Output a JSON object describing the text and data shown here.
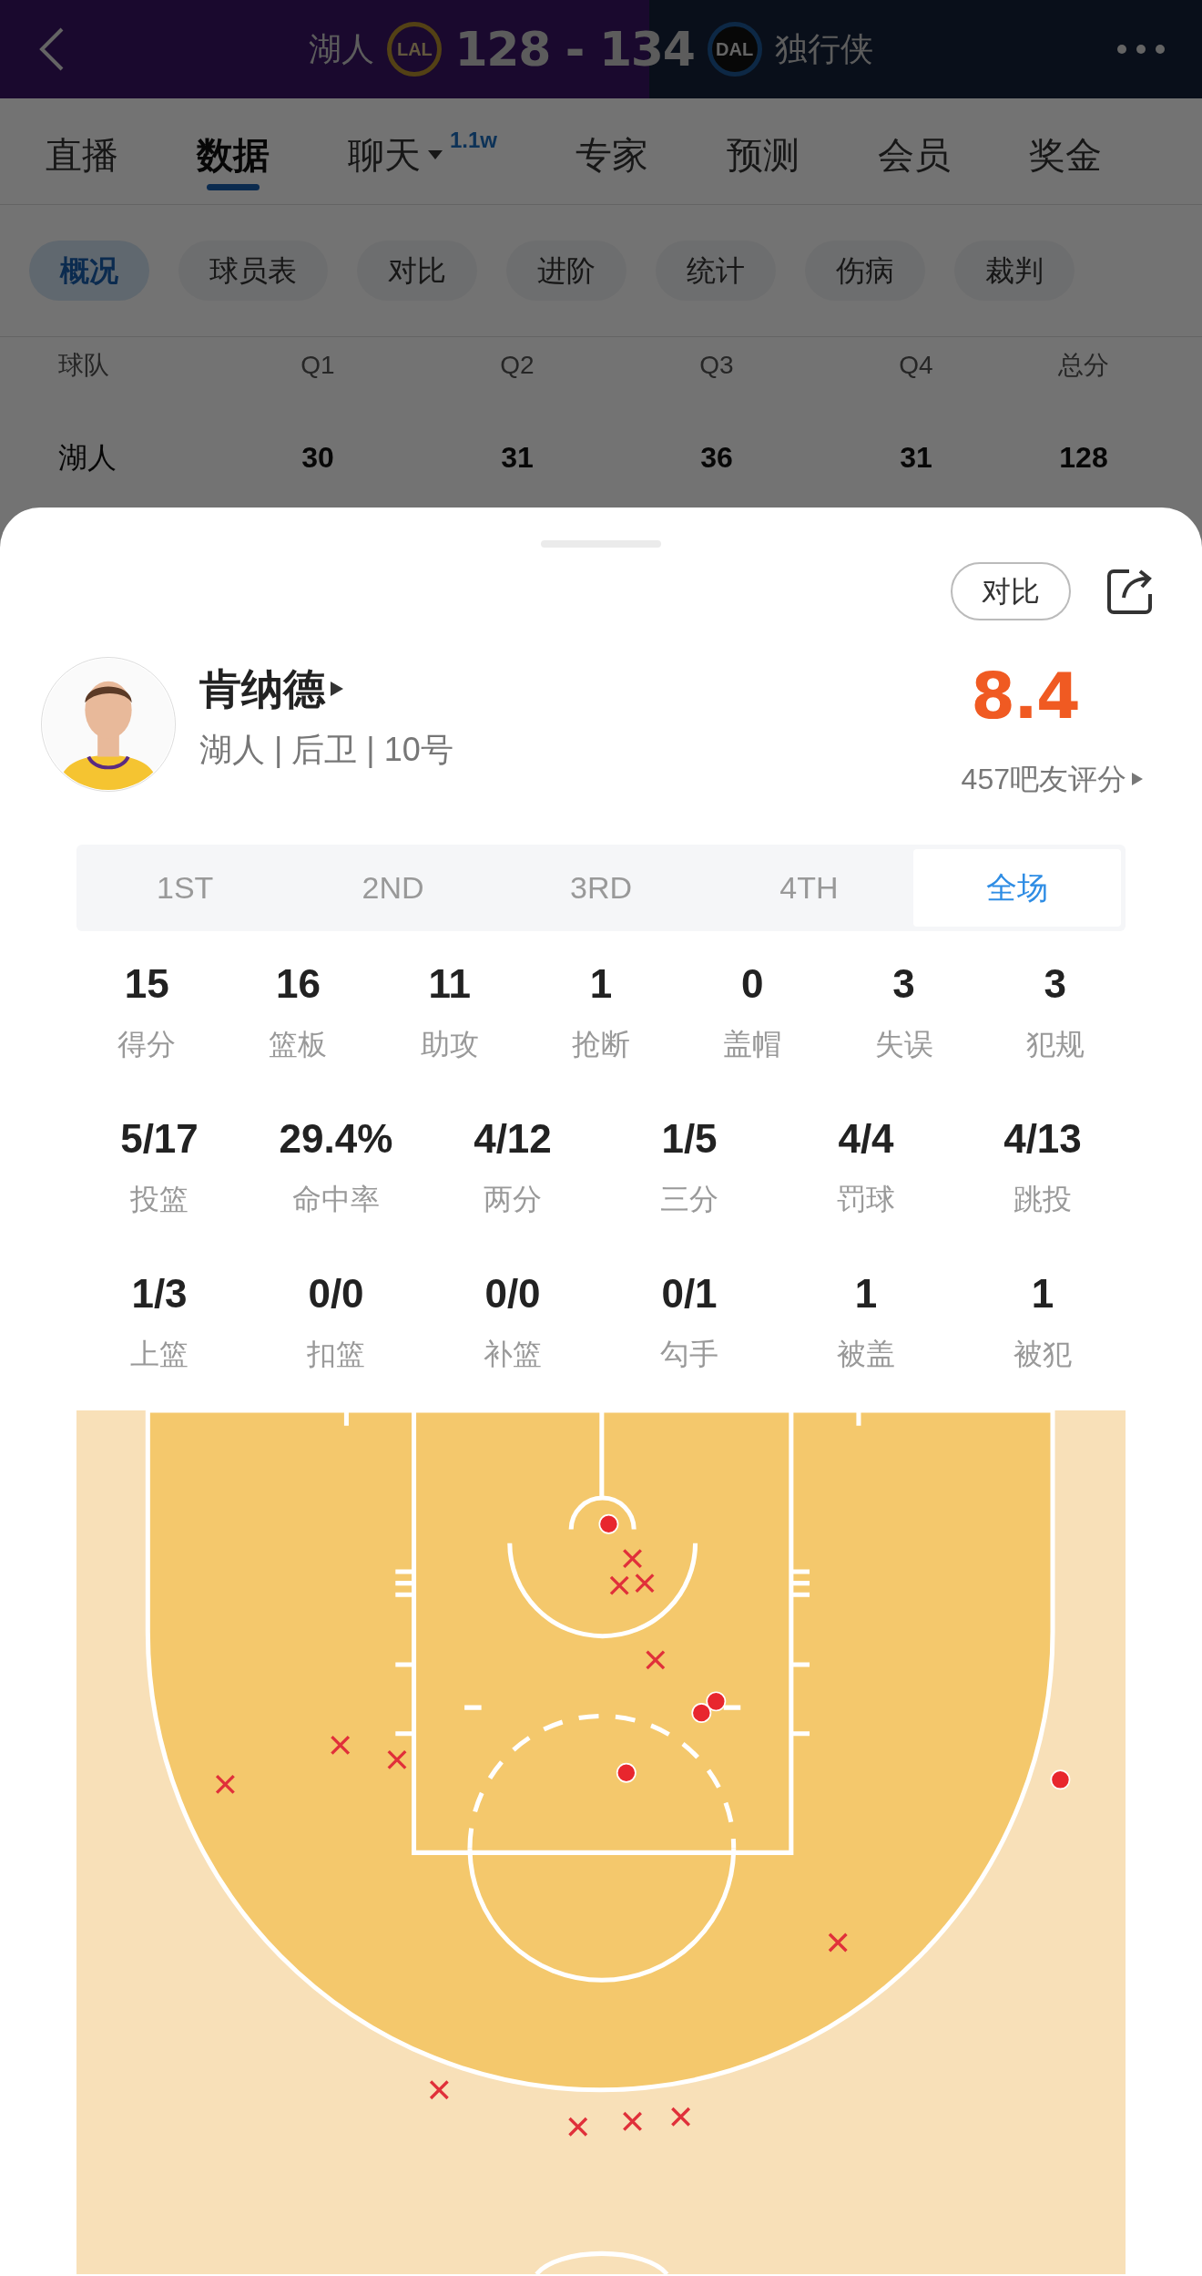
{
  "header": {
    "home_team": "湖人",
    "home_logo": "LAL",
    "score": "128 - 134",
    "away_logo": "DAL",
    "away_team": "独行侠"
  },
  "tabs": [
    {
      "label": "直播",
      "selected": false
    },
    {
      "label": "数据",
      "selected": true
    },
    {
      "label": "聊天",
      "selected": false,
      "dropdown": true,
      "badge": "1.1w"
    },
    {
      "label": "专家",
      "selected": false
    },
    {
      "label": "预测",
      "selected": false
    },
    {
      "label": "会员",
      "selected": false
    },
    {
      "label": "奖金",
      "selected": false
    }
  ],
  "chips": [
    {
      "label": "概况",
      "selected": true
    },
    {
      "label": "球员表",
      "selected": false
    },
    {
      "label": "对比",
      "selected": false
    },
    {
      "label": "进阶",
      "selected": false
    },
    {
      "label": "统计",
      "selected": false
    },
    {
      "label": "伤病",
      "selected": false
    },
    {
      "label": "裁判",
      "selected": false
    }
  ],
  "score_table": {
    "columns": [
      "球队",
      "Q1",
      "Q2",
      "Q3",
      "Q4",
      "总分"
    ],
    "rows": [
      [
        "湖人",
        "30",
        "31",
        "36",
        "31",
        "128"
      ]
    ]
  },
  "player": {
    "compare_button": "对比",
    "name": "肯纳德",
    "info": "湖人 | 后卫 | 10号",
    "rating": "8.4",
    "rating_count": "457吧友评分"
  },
  "periods": [
    {
      "label": "1ST",
      "selected": false
    },
    {
      "label": "2ND",
      "selected": false
    },
    {
      "label": "3RD",
      "selected": false
    },
    {
      "label": "4TH",
      "selected": false
    },
    {
      "label": "全场",
      "selected": true
    }
  ],
  "stats_rows": [
    [
      {
        "value": "15",
        "label": "得分"
      },
      {
        "value": "16",
        "label": "篮板"
      },
      {
        "value": "11",
        "label": "助攻"
      },
      {
        "value": "1",
        "label": "抢断"
      },
      {
        "value": "0",
        "label": "盖帽"
      },
      {
        "value": "3",
        "label": "失误"
      },
      {
        "value": "3",
        "label": "犯规"
      }
    ],
    [
      {
        "value": "5/17",
        "label": "投篮"
      },
      {
        "value": "29.4%",
        "label": "命中率"
      },
      {
        "value": "4/12",
        "label": "两分"
      },
      {
        "value": "1/5",
        "label": "三分"
      },
      {
        "value": "4/4",
        "label": "罚球"
      },
      {
        "value": "4/13",
        "label": "跳投"
      }
    ],
    [
      {
        "value": "1/3",
        "label": "上篮"
      },
      {
        "value": "0/0",
        "label": "扣篮"
      },
      {
        "value": "0/0",
        "label": "补篮"
      },
      {
        "value": "0/1",
        "label": "勾手"
      },
      {
        "value": "1",
        "label": "被盖"
      },
      {
        "value": "1",
        "label": "被犯"
      }
    ]
  ],
  "shot_chart": {
    "shots": [
      {
        "made": true
      },
      {
        "made": true
      },
      {
        "made": true
      },
      {
        "made": true
      },
      {
        "made": true
      },
      {
        "made": false
      },
      {
        "made": false
      },
      {
        "made": false
      },
      {
        "made": false
      },
      {
        "made": false
      },
      {
        "made": false
      },
      {
        "made": false
      },
      {
        "made": false
      },
      {
        "made": false
      },
      {
        "made": false
      },
      {
        "made": false
      },
      {
        "made": false
      }
    ]
  }
}
